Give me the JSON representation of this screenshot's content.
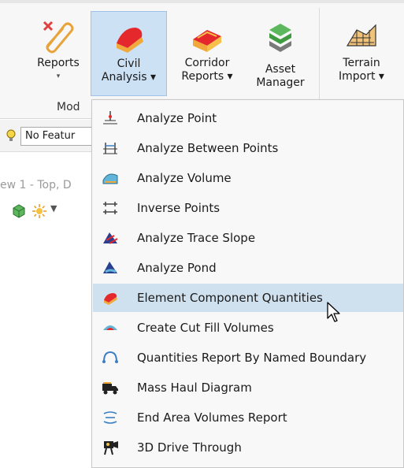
{
  "ribbon": {
    "buttons": [
      {
        "line1": "Reports",
        "line2": "▾",
        "icon": "paperclip-reports-icon"
      },
      {
        "line1": "Civil",
        "line2": "Analysis ▾",
        "icon": "civil-analysis-icon"
      },
      {
        "line1": "Corridor",
        "line2": "Reports ▾",
        "icon": "corridor-reports-icon"
      },
      {
        "line1": "Asset",
        "line2": "Manager",
        "icon": "asset-manager-icon"
      },
      {
        "line1": "Terrain",
        "line2": "Import ▾",
        "icon": "terrain-import-icon"
      }
    ],
    "group_label": "Mod"
  },
  "left_panel": {
    "feature_combo_value": "No Featur",
    "view_title": "ew 1 - Top, D"
  },
  "menu": {
    "items": [
      {
        "label": "Analyze Point",
        "icon": "analyze-point-icon"
      },
      {
        "label": "Analyze Between Points",
        "icon": "analyze-between-points-icon"
      },
      {
        "label": "Analyze Volume",
        "icon": "analyze-volume-icon"
      },
      {
        "label": "Inverse Points",
        "icon": "inverse-points-icon"
      },
      {
        "label": "Analyze Trace Slope",
        "icon": "trace-slope-icon"
      },
      {
        "label": "Analyze Pond",
        "icon": "pond-icon"
      },
      {
        "label": "Element Component Quantities",
        "icon": "component-quantities-icon",
        "highlighted": true
      },
      {
        "label": "Create Cut Fill Volumes",
        "icon": "cut-fill-icon"
      },
      {
        "label": "Quantities Report By Named Boundary",
        "icon": "named-boundary-icon"
      },
      {
        "label": "Mass Haul Diagram",
        "icon": "mass-haul-truck-icon"
      },
      {
        "label": "End Area Volumes Report",
        "icon": "end-area-icon"
      },
      {
        "label": "3D Drive Through",
        "icon": "drive-through-icon"
      }
    ]
  },
  "colors": {
    "highlight": "#cfe0ee",
    "active_button": "#cde1f5"
  }
}
